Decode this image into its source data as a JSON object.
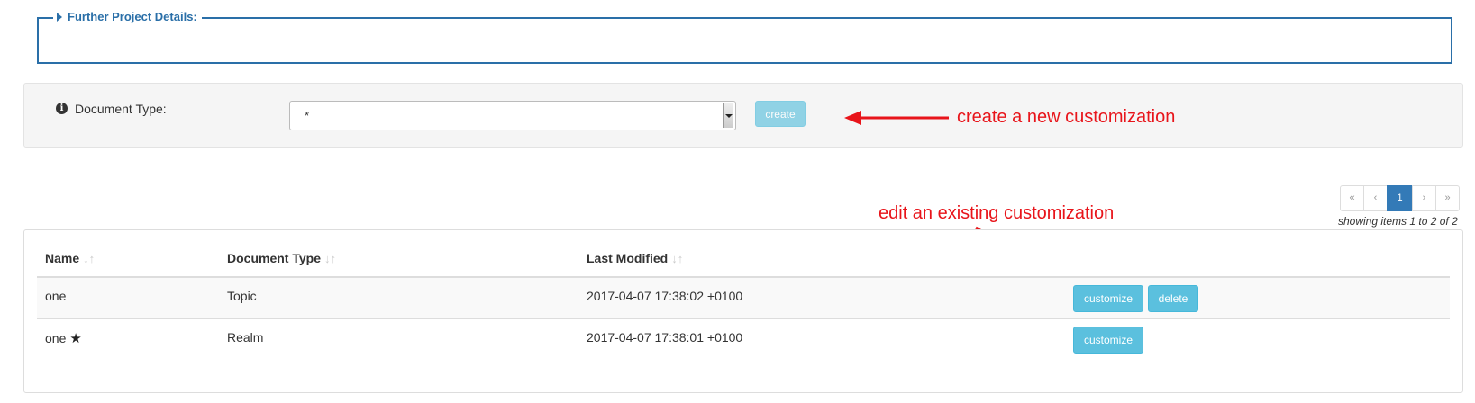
{
  "project_details": {
    "legend": "Further Project Details:"
  },
  "doc_type": {
    "label": "Document Type:",
    "selected": "*",
    "create_label": "create"
  },
  "annotations": {
    "create": "create a new customization",
    "edit": "edit an existing customization",
    "color": "#e8141a"
  },
  "pagination": {
    "first": "«",
    "prev": "‹",
    "current": "1",
    "next": "›",
    "last": "»",
    "showing": "showing items 1 to 2 of 2"
  },
  "table": {
    "headers": [
      "Name",
      "Document Type",
      "Last Modified"
    ],
    "sort_glyph": "↓↑",
    "rows": [
      {
        "name": "one",
        "star": "",
        "doc_type": "Topic",
        "modified": "2017-04-07 17:38:02 +0100",
        "actions": [
          "customize",
          "delete"
        ]
      },
      {
        "name": "one",
        "star": "★",
        "doc_type": "Realm",
        "modified": "2017-04-07 17:38:01 +0100",
        "actions": [
          "customize"
        ]
      }
    ]
  },
  "colors": {
    "accent": "#2a6fa8",
    "button": "#5bc0de",
    "active_page": "#337ab7"
  },
  "icons": {
    "legend": "caret-right-icon",
    "info": "info-circle-icon",
    "favorite": "star-icon"
  }
}
